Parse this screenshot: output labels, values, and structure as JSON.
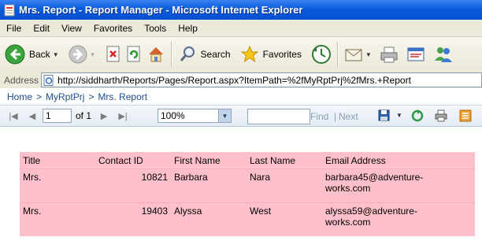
{
  "window": {
    "title": "Mrs. Report - Report Manager - Microsoft Internet Explorer"
  },
  "menu": [
    "File",
    "Edit",
    "View",
    "Favorites",
    "Tools",
    "Help"
  ],
  "toolbar": {
    "back_label": "Back",
    "search_label": "Search",
    "favorites_label": "Favorites"
  },
  "address": {
    "label": "Address",
    "url": "http://siddharth/Reports/Pages/Report.aspx?ItemPath=%2fMyRptPrj%2fMrs.+Report"
  },
  "breadcrumb": {
    "home": "Home",
    "project": "MyRptPrj",
    "report": "Mrs. Report",
    "separator": ">"
  },
  "report_toolbar": {
    "page_value": "1",
    "of_text": "of 1",
    "zoom_value": "100%",
    "find_placeholder": "",
    "find_label": "Find",
    "separator": "|",
    "next_label": "Next"
  },
  "report": {
    "columns": [
      "Title",
      "Contact ID",
      "First Name",
      "Last Name",
      "Email Address"
    ],
    "rows": [
      {
        "title": "Mrs.",
        "contact_id": "10821",
        "first_name": "Barbara",
        "last_name": "Nara",
        "email_line1": "barbara45@adventure-",
        "email_line2": "works.com"
      },
      {
        "title": "Mrs.",
        "contact_id": "19403",
        "first_name": "Alyssa",
        "last_name": "West",
        "email_line1": "alyssa59@adventure-",
        "email_line2": "works.com"
      }
    ],
    "background_color": "#ffc0cb"
  }
}
